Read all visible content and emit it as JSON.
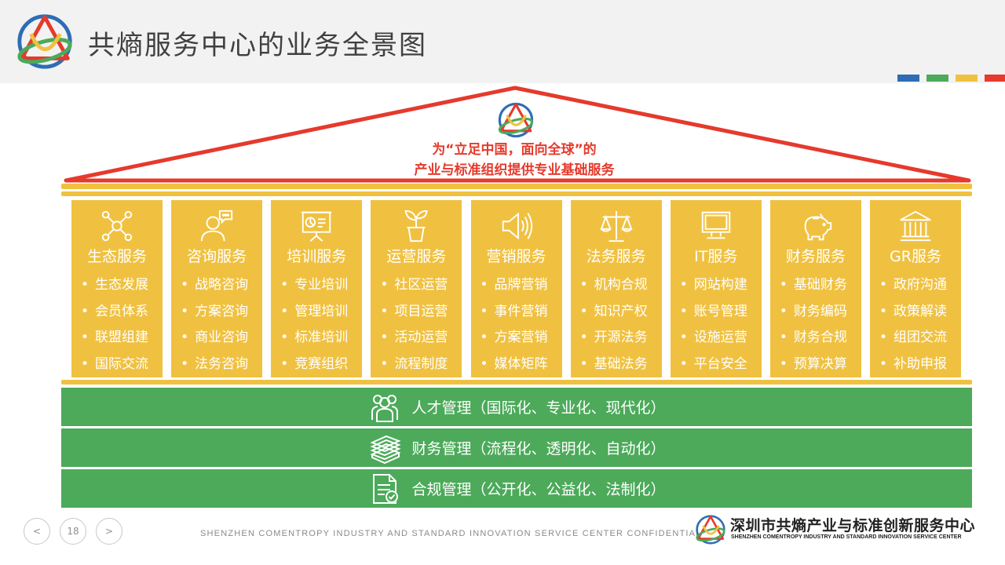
{
  "header": {
    "title": "共熵服务中心的业务全景图"
  },
  "accent_colors": [
    "#2e6db5",
    "#4caa5a",
    "#f0c141",
    "#e53a2c"
  ],
  "roof": {
    "slogan_line1": "为“立足中国，面向全球”的",
    "slogan_line2": "产业与标准组织提供专业基础服务"
  },
  "pillars": [
    {
      "name": "生态服务",
      "icon": "network-icon",
      "items": [
        "生态发展",
        "会员体系",
        "联盟组建",
        "国际交流"
      ]
    },
    {
      "name": "咨询服务",
      "icon": "consultant-icon",
      "items": [
        "战略咨询",
        "方案咨询",
        "商业咨询",
        "法务咨询"
      ]
    },
    {
      "name": "培训服务",
      "icon": "presentation-board-icon",
      "items": [
        "专业培训",
        "管理培训",
        "标准培训",
        "竞赛组织"
      ]
    },
    {
      "name": "运营服务",
      "icon": "plant-pot-icon",
      "items": [
        "社区运营",
        "项目运营",
        "活动运营",
        "流程制度"
      ]
    },
    {
      "name": "营销服务",
      "icon": "speaker-icon",
      "items": [
        "品牌营销",
        "事件营销",
        "方案营销",
        "媒体矩阵"
      ]
    },
    {
      "name": "法务服务",
      "icon": "scales-icon",
      "items": [
        "机构合规",
        "知识产权",
        "开源法务",
        "基础法务"
      ]
    },
    {
      "name": "IT服务",
      "icon": "monitor-icon",
      "items": [
        "网站构建",
        "账号管理",
        "设施运营",
        "平台安全"
      ]
    },
    {
      "name": "财务服务",
      "icon": "piggy-bank-icon",
      "items": [
        "基础财务",
        "财务编码",
        "财务合规",
        "预算决算"
      ]
    },
    {
      "name": "GR服务",
      "icon": "government-building-icon",
      "items": [
        "政府沟通",
        "政策解读",
        "组团交流",
        "补助申报"
      ]
    }
  ],
  "foundations": [
    {
      "label": "人才管理（国际化、专业化、现代化）",
      "icon": "people-icon"
    },
    {
      "label": "财务管理（流程化、透明化、自动化）",
      "icon": "money-stack-icon"
    },
    {
      "label": "合规管理（公开化、公益化、法制化）",
      "icon": "compliance-document-icon"
    }
  ],
  "footer": {
    "prev": "<",
    "page_number": "18",
    "next": ">",
    "confidential": "SHENZHEN COMENTROPY INDUSTRY AND STANDARD INNOVATION SERVICE CENTER CONFIDENTIAL",
    "org_name_cn": "深圳市共熵产业与标准创新服务中心",
    "org_name_en": "SHENZHEN COMENTROPY INDUSTRY AND STANDARD INNOVATION SERVICE CENTER"
  }
}
